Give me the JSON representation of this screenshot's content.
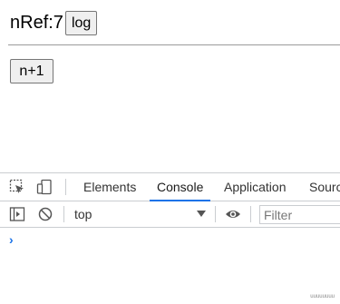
{
  "page": {
    "nref_label": "nRef:7",
    "log_button": "log",
    "increment_button": "n+1"
  },
  "devtools": {
    "tabs": [
      "Elements",
      "Console",
      "Application",
      "Sources"
    ],
    "active_tab": "Console",
    "context": "top",
    "filter_placeholder": "Filter",
    "prompt": "›",
    "corner_text": "uuuuuuuu"
  },
  "colors": {
    "accent": "#1a73e8",
    "border": "#cacdd1",
    "button_bg": "#efefef"
  }
}
